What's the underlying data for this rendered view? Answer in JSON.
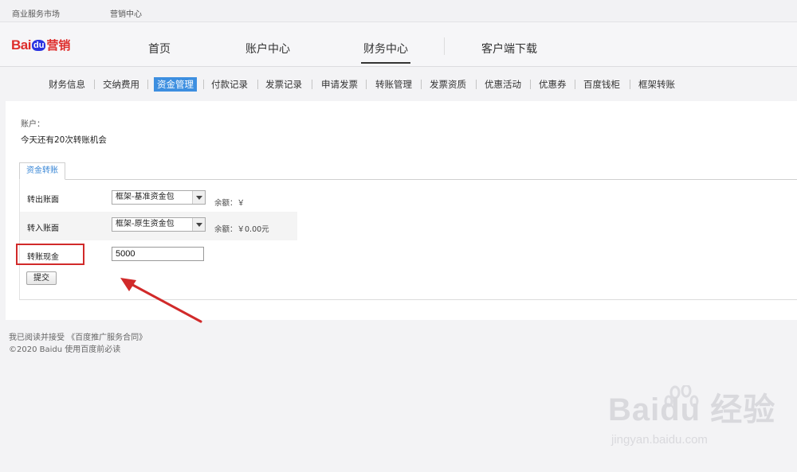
{
  "topbar": {
    "market": "商业服务市场",
    "marketing_center": "营销中心"
  },
  "logo": {
    "bai": "Bai",
    "du": "du",
    "yingxiao": "营销"
  },
  "main_nav": {
    "home": "首页",
    "account_center": "账户中心",
    "finance_center": "财务中心",
    "client_download": "客户端下载",
    "active": "财务中心"
  },
  "sub_nav": [
    "财务信息",
    "交纳费用",
    "资金管理",
    "付款记录",
    "发票记录",
    "申请发票",
    "转账管理",
    "发票资质",
    "优惠活动",
    "优惠券",
    "百度钱柜",
    "框架转账"
  ],
  "sub_nav_active": "资金管理",
  "account": {
    "label": "账户：",
    "tip": "今天还有20次转账机会"
  },
  "tab": {
    "label": "资金转账"
  },
  "form": {
    "from_label": "转出账面",
    "from_value": "框架-基准资金包",
    "from_balance": "余额：￥",
    "to_label": "转入账面",
    "to_value": "框架-原生资金包",
    "to_balance": "余额：￥0.00元",
    "amount_label": "转账现金",
    "amount_value": "5000",
    "submit_label": "提交"
  },
  "footer": {
    "line1": "我已阅读并接受 《百度推广服务合同》",
    "line2": "©2020 Baidu 使用百度前必读"
  },
  "watermark": {
    "brand": "Baidu 经验",
    "url": "jingyan.baidu.com"
  },
  "colors": {
    "accent": "#3d8fe0",
    "brand_red": "#de2d2b",
    "highlight_red": "#d12a2a"
  }
}
